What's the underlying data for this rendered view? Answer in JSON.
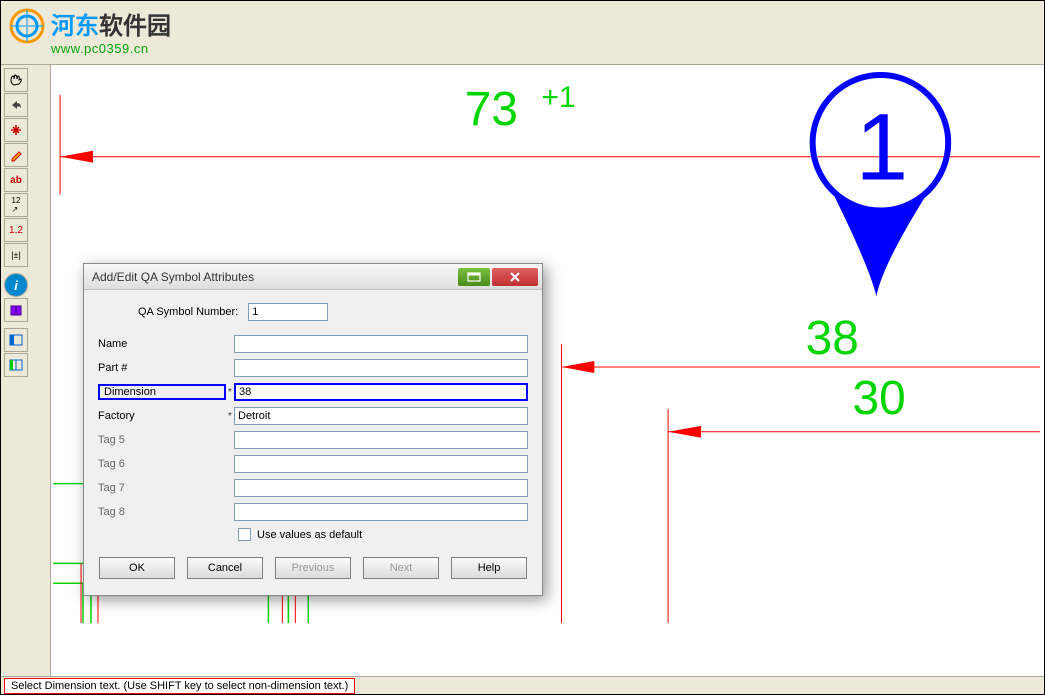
{
  "watermark": {
    "text_zh": "河东软件园",
    "url": "www.pc0359.cn"
  },
  "dialog": {
    "title": "Add/Edit QA Symbol Attributes",
    "qa_symbol_label": "QA Symbol Number:",
    "qa_symbol_value": "1",
    "rows": {
      "name": {
        "label": "Name",
        "value": "",
        "star": ""
      },
      "part": {
        "label": "Part #",
        "value": "",
        "star": ""
      },
      "dimension": {
        "label": "Dimension",
        "value": "38",
        "star": "*"
      },
      "factory": {
        "label": "Factory",
        "value": "Detroit",
        "star": "*"
      },
      "tag5": {
        "label": "Tag 5",
        "value": "",
        "star": ""
      },
      "tag6": {
        "label": "Tag 6",
        "value": "",
        "star": ""
      },
      "tag7": {
        "label": "Tag 7",
        "value": "",
        "star": ""
      },
      "tag8": {
        "label": "Tag 8",
        "value": "",
        "star": ""
      }
    },
    "use_defaults_label": "Use values as default",
    "buttons": {
      "ok": "OK",
      "cancel": "Cancel",
      "previous": "Previous",
      "next": "Next",
      "help": "Help"
    }
  },
  "canvas": {
    "dim_main": "73",
    "dim_tol_upper": "+1",
    "dim_38": "38",
    "dim_30": "30",
    "balloon_number": "1"
  },
  "status": {
    "message": "Select Dimension text.  (Use SHIFT key to select non-dimension text.)"
  },
  "toolbar": {
    "icons": [
      "new",
      "open",
      "save",
      "print",
      "cut",
      "copy",
      "paste",
      "undo",
      "redo",
      "zoom-in",
      "zoom-out",
      "zoom-fit",
      "pan",
      "layer",
      "snap",
      "grid"
    ],
    "left_icons": [
      "pan-tool",
      "undo-tool",
      "free-move",
      "pencil",
      "text-ab",
      "dim-12",
      "dim-tol",
      "info",
      "book",
      "panel-left",
      "panel-split"
    ]
  }
}
